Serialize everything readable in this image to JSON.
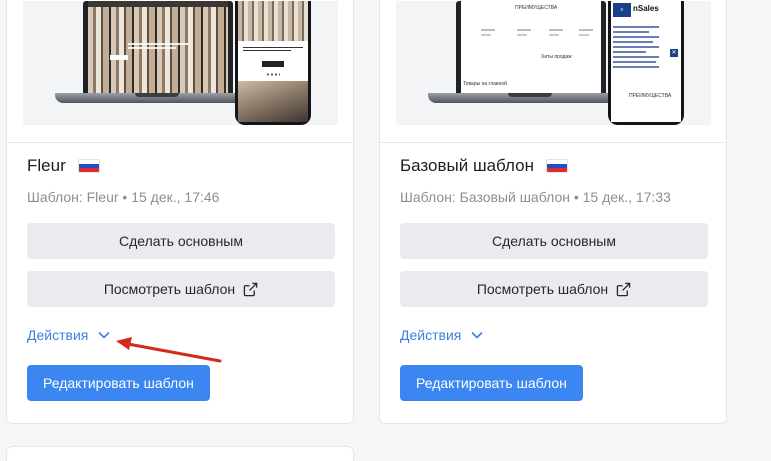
{
  "cards": [
    {
      "title": "Fleur",
      "meta": "Шаблон: Fleur • 15 дек., 17:46",
      "make_default_label": "Сделать основным",
      "view_template_label": "Посмотреть шаблон",
      "actions_label": "Действия",
      "edit_label": "Редактировать шаблон",
      "flag": "russia-flag-icon"
    },
    {
      "title": "Базовый шаблон",
      "meta": "Шаблон: Базовый шаблон • 15 дек., 17:33",
      "make_default_label": "Сделать основным",
      "view_template_label": "Посмотреть шаблон",
      "actions_label": "Действия",
      "edit_label": "Редактировать шаблон",
      "flag": "russia-flag-icon"
    }
  ],
  "preview_base": {
    "advantages_top": "ПРЕИМУЩЕСТВА",
    "hits": "Хиты продаж",
    "new_products": "Товары на главной",
    "phone_brand": "nSales",
    "advantages_phone": "ПРЕИМУЩЕСТВА"
  },
  "colors": {
    "accent": "#3b86f0",
    "link": "#3d80e0",
    "annotation": "#d42a1e",
    "flag_white": "#ffffff",
    "flag_blue": "#1f4fc9",
    "flag_red": "#e02a2a"
  }
}
